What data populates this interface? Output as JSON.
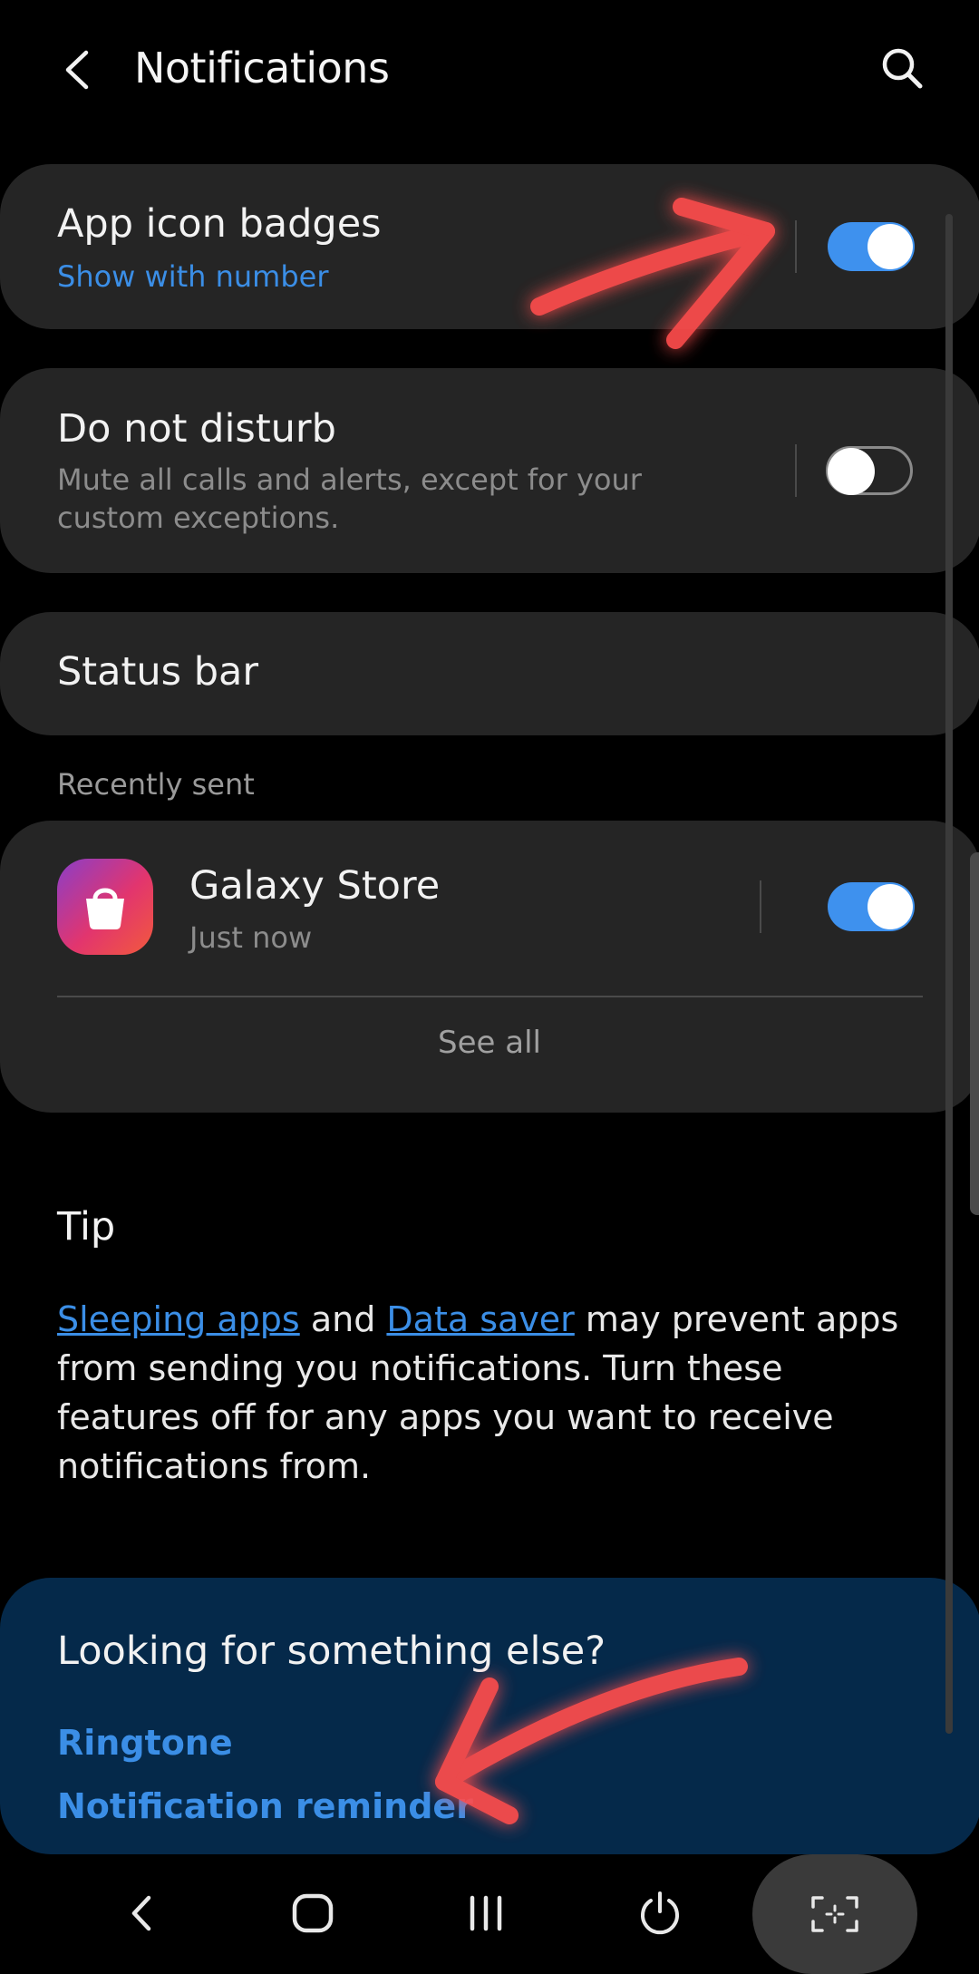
{
  "header": {
    "title": "Notifications",
    "back_icon": "back-arrow-icon",
    "search_icon": "search-icon"
  },
  "app_icon_badges": {
    "title": "App icon badges",
    "subtitle": "Show with number",
    "enabled": true
  },
  "do_not_disturb": {
    "title": "Do not disturb",
    "subtitle": "Mute all calls and alerts, except for your custom exceptions.",
    "enabled": false
  },
  "status_bar": {
    "title": "Status bar"
  },
  "recently_sent": {
    "label": "Recently sent",
    "apps": [
      {
        "name": "Galaxy Store",
        "time": "Just now",
        "icon": "shopping-bag-icon",
        "enabled": true
      }
    ],
    "see_all": "See all"
  },
  "tip": {
    "title": "Tip",
    "link1": "Sleeping apps",
    "and": "and",
    "link2": "Data saver",
    "text_after": "may prevent apps from sending you notifications. Turn these features off for any apps you want to receive notifications from."
  },
  "suggestions": {
    "title": "Looking for something else?",
    "links": [
      "Ringtone",
      "Notification reminder"
    ]
  },
  "nav": {
    "back_icon": "back-icon",
    "home_icon": "home-icon",
    "recents_icon": "recents-icon",
    "power_icon": "power-icon",
    "capture_icon": "screen-capture-icon"
  },
  "colors": {
    "background": "#000000",
    "card": "#252525",
    "accent": "#3e91ee",
    "link": "#3b8ee6",
    "suggestion_card": "#05294a",
    "annotation_arrow": "#ff4d4d"
  }
}
